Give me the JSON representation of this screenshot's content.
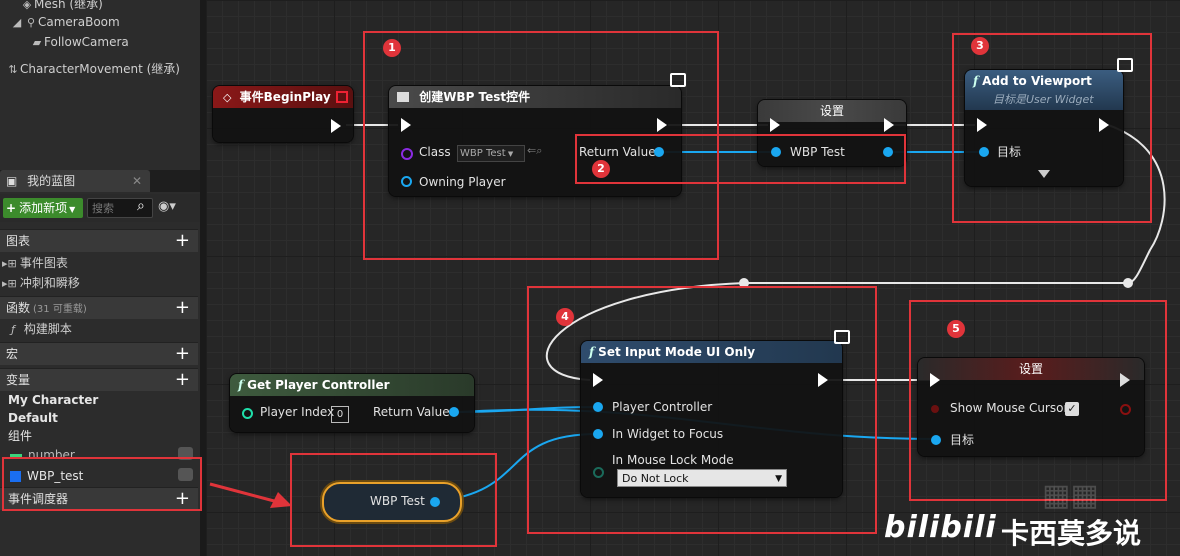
{
  "left_panel": {
    "components": [
      {
        "label": "Mesh (继承)"
      },
      {
        "label": "CameraBoom"
      },
      {
        "label": "FollowCamera"
      },
      {
        "label": "CharacterMovement (继承)"
      }
    ],
    "tab_label": "我的蓝图",
    "add_new_label": "添加新项",
    "search_placeholder": "搜索",
    "sections": {
      "graphs": "图表",
      "event_graph": "事件图表",
      "sprint": "冲刺和瞬移",
      "functions": "函数",
      "functions_count": "(31 可重载)",
      "construction_script": "构建脚本",
      "macros": "宏",
      "variables": "变量",
      "my_character": "My Character",
      "default": "Default",
      "components": "组件",
      "number_var": "number",
      "wbp_test_var": "WBP_test",
      "event_dispatchers": "事件调度器"
    }
  },
  "graph": {
    "event_begin_play": {
      "title": "事件BeginPlay"
    },
    "create_widget": {
      "title": "创建WBP Test控件",
      "class_label": "Class",
      "class_value": "WBP Test",
      "owning_player": "Owning Player",
      "return_value": "Return Value"
    },
    "set_var": {
      "title": "设置",
      "pin": "WBP Test"
    },
    "add_viewport": {
      "title": "Add to Viewport",
      "subtitle": "目标是User Widget",
      "target": "目标"
    },
    "get_pc": {
      "title": "Get Player Controller",
      "player_index": "Player Index",
      "player_index_value": "0",
      "return_value": "Return Value"
    },
    "set_input_mode": {
      "title": "Set Input Mode UI Only",
      "player_controller": "Player Controller",
      "widget_focus": "In Widget to Focus",
      "mouse_lock": "In Mouse Lock Mode",
      "mouse_lock_value": "Do Not Lock"
    },
    "set_cursor": {
      "title": "设置",
      "show_cursor": "Show Mouse Cursor",
      "target": "目标"
    },
    "wbp_getter": {
      "label": "WBP Test"
    },
    "badges": [
      "1",
      "2",
      "3",
      "4",
      "5"
    ]
  },
  "watermark": {
    "text": "卡西莫多说",
    "logo": "bilibili"
  },
  "colors": {
    "pin_blue": "#1aa7f0",
    "event_red": "#7a1414",
    "annotation_red": "#e0343a",
    "add_button": "#3c8b2c"
  }
}
